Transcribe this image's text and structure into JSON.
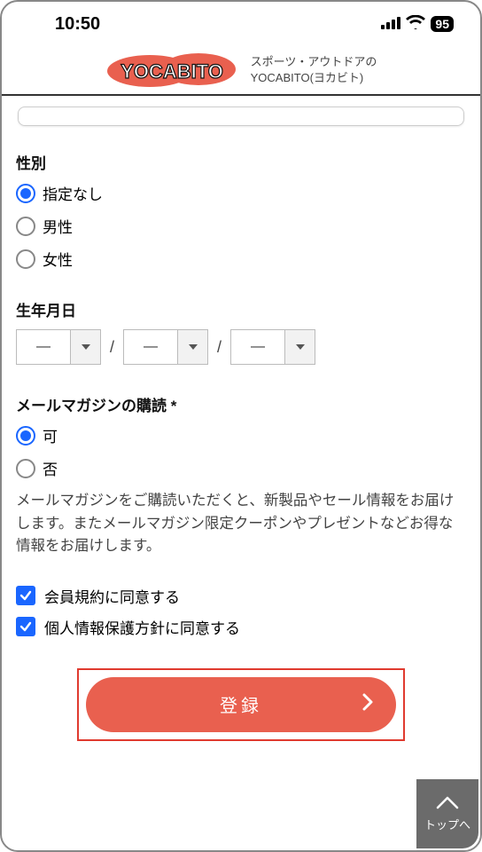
{
  "status": {
    "time": "10:50",
    "battery": "95"
  },
  "header": {
    "logo_text": "YOCABITO",
    "tagline_line1": "スポーツ・アウトドアの",
    "tagline_line2": "YOCABITO(ヨカビト)"
  },
  "gender": {
    "label": "性別",
    "options": {
      "none": "指定なし",
      "male": "男性",
      "female": "女性"
    },
    "selected": "none"
  },
  "dob": {
    "label": "生年月日",
    "year": "—",
    "month": "—",
    "day": "—",
    "sep": "/"
  },
  "mailmag": {
    "label": "メールマガジンの購読 *",
    "options": {
      "yes": "可",
      "no": "否"
    },
    "selected": "yes",
    "note": "メールマガジンをご購読いただくと、新製品やセール情報をお届けします。またメールマガジン限定クーポンやプレゼントなどお得な情報をお届けします。"
  },
  "agreements": {
    "terms": "会員規約に同意する",
    "privacy": "個人情報保護方針に同意する"
  },
  "submit": {
    "label": "登録"
  },
  "to_top": {
    "label": "トップへ"
  }
}
